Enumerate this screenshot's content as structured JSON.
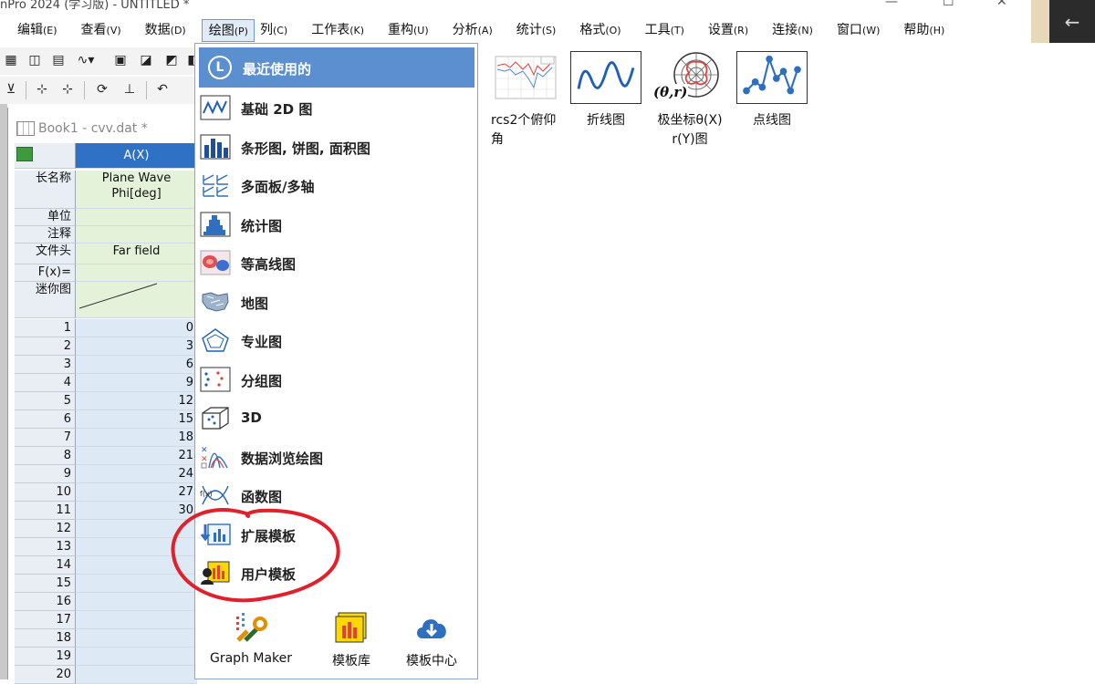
{
  "window": {
    "title": "nPro 2024 (学习版) - UNTITLED *",
    "minimize": "—",
    "maximize": "☐",
    "close": "✕"
  },
  "desktop": {
    "back_arrow": "←"
  },
  "menubar": [
    {
      "label": "编辑",
      "acc": "(E)"
    },
    {
      "label": "查看",
      "acc": "(V)"
    },
    {
      "label": "数据",
      "acc": "(D)"
    },
    {
      "label": "绘图",
      "acc": "(P)"
    },
    {
      "label": "列",
      "acc": "(C)"
    },
    {
      "label": "工作表",
      "acc": "(K)"
    },
    {
      "label": "重构",
      "acc": "(U)"
    },
    {
      "label": "分析",
      "acc": "(A)"
    },
    {
      "label": "统计",
      "acc": "(S)"
    },
    {
      "label": "格式",
      "acc": "(O)"
    },
    {
      "label": "工具",
      "acc": "(T)"
    },
    {
      "label": "设置",
      "acc": "(R)"
    },
    {
      "label": "连接",
      "acc": "(N)"
    },
    {
      "label": "窗口",
      "acc": "(W)"
    },
    {
      "label": "帮助",
      "acc": "(H)"
    }
  ],
  "workbook": {
    "title": "Book1 - cvv.dat *",
    "column_header": "A(X)",
    "row_labels": {
      "long_name": "长名称",
      "units": "单位",
      "comments": "注释",
      "file_header": "文件头",
      "fx": "F(x)=",
      "sparkline": "迷你图"
    },
    "long_name_value": "Plane Wave Phi[deg]",
    "file_header_value": "Far field",
    "rows": [
      "1",
      "2",
      "3",
      "4",
      "5",
      "6",
      "7",
      "8",
      "9",
      "10",
      "11",
      "12",
      "13",
      "14",
      "15",
      "16",
      "17",
      "18",
      "19",
      "20"
    ],
    "values": [
      "0",
      "3",
      "6",
      "9",
      "12",
      "15",
      "18",
      "21",
      "24",
      "27",
      "30",
      "",
      "",
      "",
      "",
      "",
      "",
      "",
      "",
      ""
    ]
  },
  "plot_menu": {
    "recent": "最近使用的",
    "items": [
      {
        "label": "基础 2D 图",
        "icon": "line-chart-icon"
      },
      {
        "label": "条形图, 饼图, 面积图",
        "icon": "bar-chart-icon"
      },
      {
        "label": "多面板/多轴",
        "icon": "multi-panel-icon"
      },
      {
        "label": "统计图",
        "icon": "histogram-icon"
      },
      {
        "label": "等高线图",
        "icon": "contour-icon"
      },
      {
        "label": "地图",
        "icon": "map-icon"
      },
      {
        "label": "专业图",
        "icon": "radar-icon"
      },
      {
        "label": "分组图",
        "icon": "grouped-icon"
      },
      {
        "label": "3D",
        "icon": "3d-cube-icon"
      },
      {
        "label": "数据浏览绘图",
        "icon": "data-explore-icon"
      },
      {
        "label": "函数图",
        "icon": "function-plot-icon"
      },
      {
        "label": "扩展模板",
        "icon": "extend-template-icon"
      },
      {
        "label": "用户模板",
        "icon": "user-template-icon"
      }
    ],
    "bottom": [
      {
        "label": "Graph Maker",
        "icon": "graph-maker-icon"
      },
      {
        "label": "模板库",
        "icon": "template-library-icon"
      },
      {
        "label": "模板中心",
        "icon": "template-center-cloud-icon"
      }
    ]
  },
  "gallery": [
    {
      "label": "rcs2个俯仰角"
    },
    {
      "label": "折线图"
    },
    {
      "label": "极坐标θ(X) r(Y)图",
      "overlay": "(θ,r)"
    },
    {
      "label": "点线图"
    }
  ],
  "colors": {
    "menu_highlight": "#5b8fd0",
    "annotation": "#e0202a",
    "data_bg": "#ddeaf6",
    "meta_bg": "#e4f2d9"
  }
}
